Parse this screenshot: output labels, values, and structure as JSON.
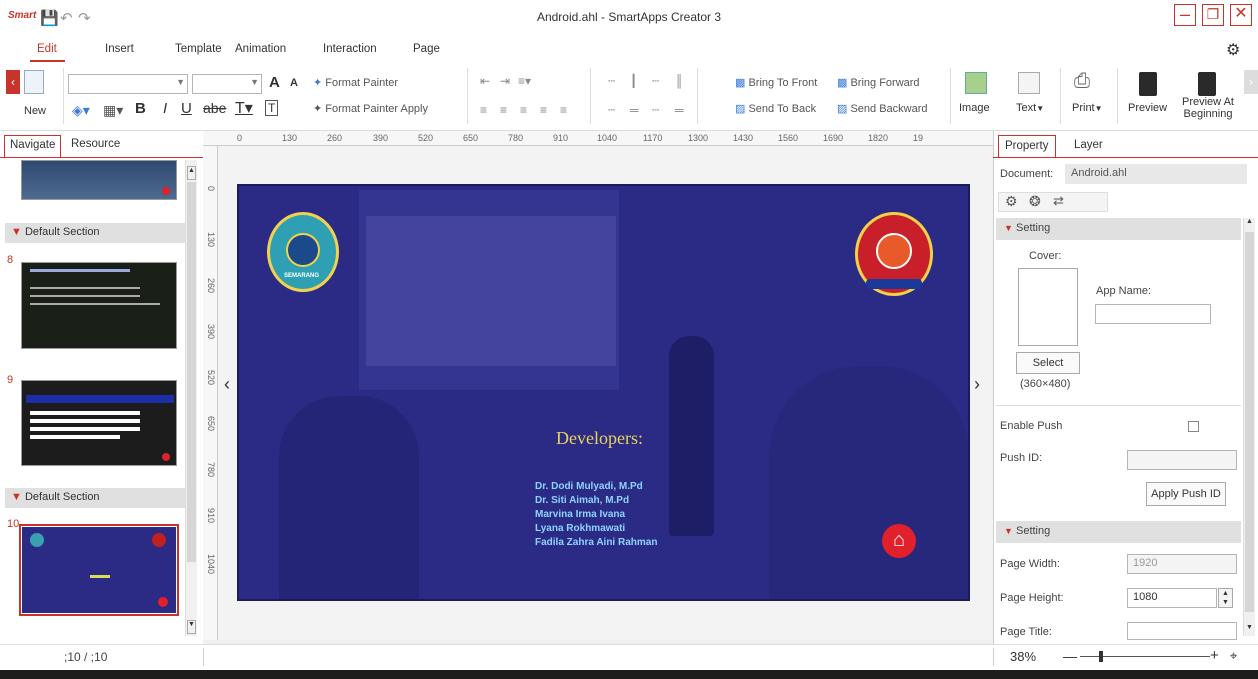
{
  "app": {
    "logo": "Smart",
    "title": "Android.ahl - SmartApps Creator 3",
    "window_controls": [
      "minimize-icon",
      "restore-icon",
      "close-icon"
    ]
  },
  "menu": [
    "Edit",
    "Insert",
    "Template",
    "Animation",
    "Interaction",
    "Page"
  ],
  "ribbon": {
    "new": "New",
    "format_painter": "Format Painter",
    "format_painter_apply": "Format Painter Apply",
    "bring_to_front": "Bring To Front",
    "bring_forward": "Bring Forward",
    "send_to_back": "Send To Back",
    "send_backward": "Send Backward",
    "image": "Image",
    "text": "Text",
    "print": "Print",
    "preview": "Preview",
    "preview_at_beginning_1": "Preview At",
    "preview_at_beginning_2": "Beginning",
    "bold": "B",
    "italic": "I",
    "underline": "U",
    "strike": "abe",
    "grow_font": "A",
    "shrink_font": "A"
  },
  "left_panel": {
    "tabs": [
      "Navigate",
      "Resource"
    ],
    "sections": [
      "Default Section",
      "Default Section"
    ],
    "page_numbers": [
      "8",
      "9",
      "10"
    ]
  },
  "ruler": {
    "h_ticks": [
      "0",
      "130",
      "260",
      "390",
      "520",
      "650",
      "780",
      "910",
      "1040",
      "1170",
      "1300",
      "1430",
      "1560",
      "1690",
      "1820",
      "19"
    ],
    "v_ticks": [
      "0",
      "130",
      "260",
      "390",
      "520",
      "650",
      "780",
      "910",
      "1040"
    ]
  },
  "slide": {
    "heading": "Developers:",
    "names": [
      "Dr. Dodi Mulyadi, M.Pd",
      "Dr. Siti Aimah, M.Pd",
      "Marvina Irma Ivana",
      "Lyana Rokhmawati",
      "Fadila Zahra Aini Rahman"
    ],
    "logo_left": "UNIVERSITAS MUHAMMADIYAH SEMARANG",
    "logo_right": "FAKULTAS BAHASA DAN SASTRA",
    "logo_left_label": "SEMARANG"
  },
  "right_panel": {
    "tabs": [
      "Property",
      "Layer"
    ],
    "document_label": "Document:",
    "document_value": "Android.ahl",
    "setting_1": "Setting",
    "cover_label": "Cover:",
    "app_name_label": "App Name:",
    "select_button": "Select",
    "cover_size": "(360×480)",
    "enable_push": "Enable Push",
    "push_id": "Push ID:",
    "apply_push_id": "Apply Push ID",
    "setting_2": "Setting",
    "page_width_label": "Page Width:",
    "page_width": "1920",
    "page_height_label": "Page Height:",
    "page_height": "1080",
    "page_title_label": "Page Title:"
  },
  "status": {
    "page_counter": ";10 / ;10",
    "zoom": "38%"
  },
  "colors": {
    "accent": "#c8342a",
    "slide_bg": "#2b2b86",
    "heading": "#e8d35a",
    "names": "#8fd3ff",
    "home_button": "#e0202a"
  }
}
